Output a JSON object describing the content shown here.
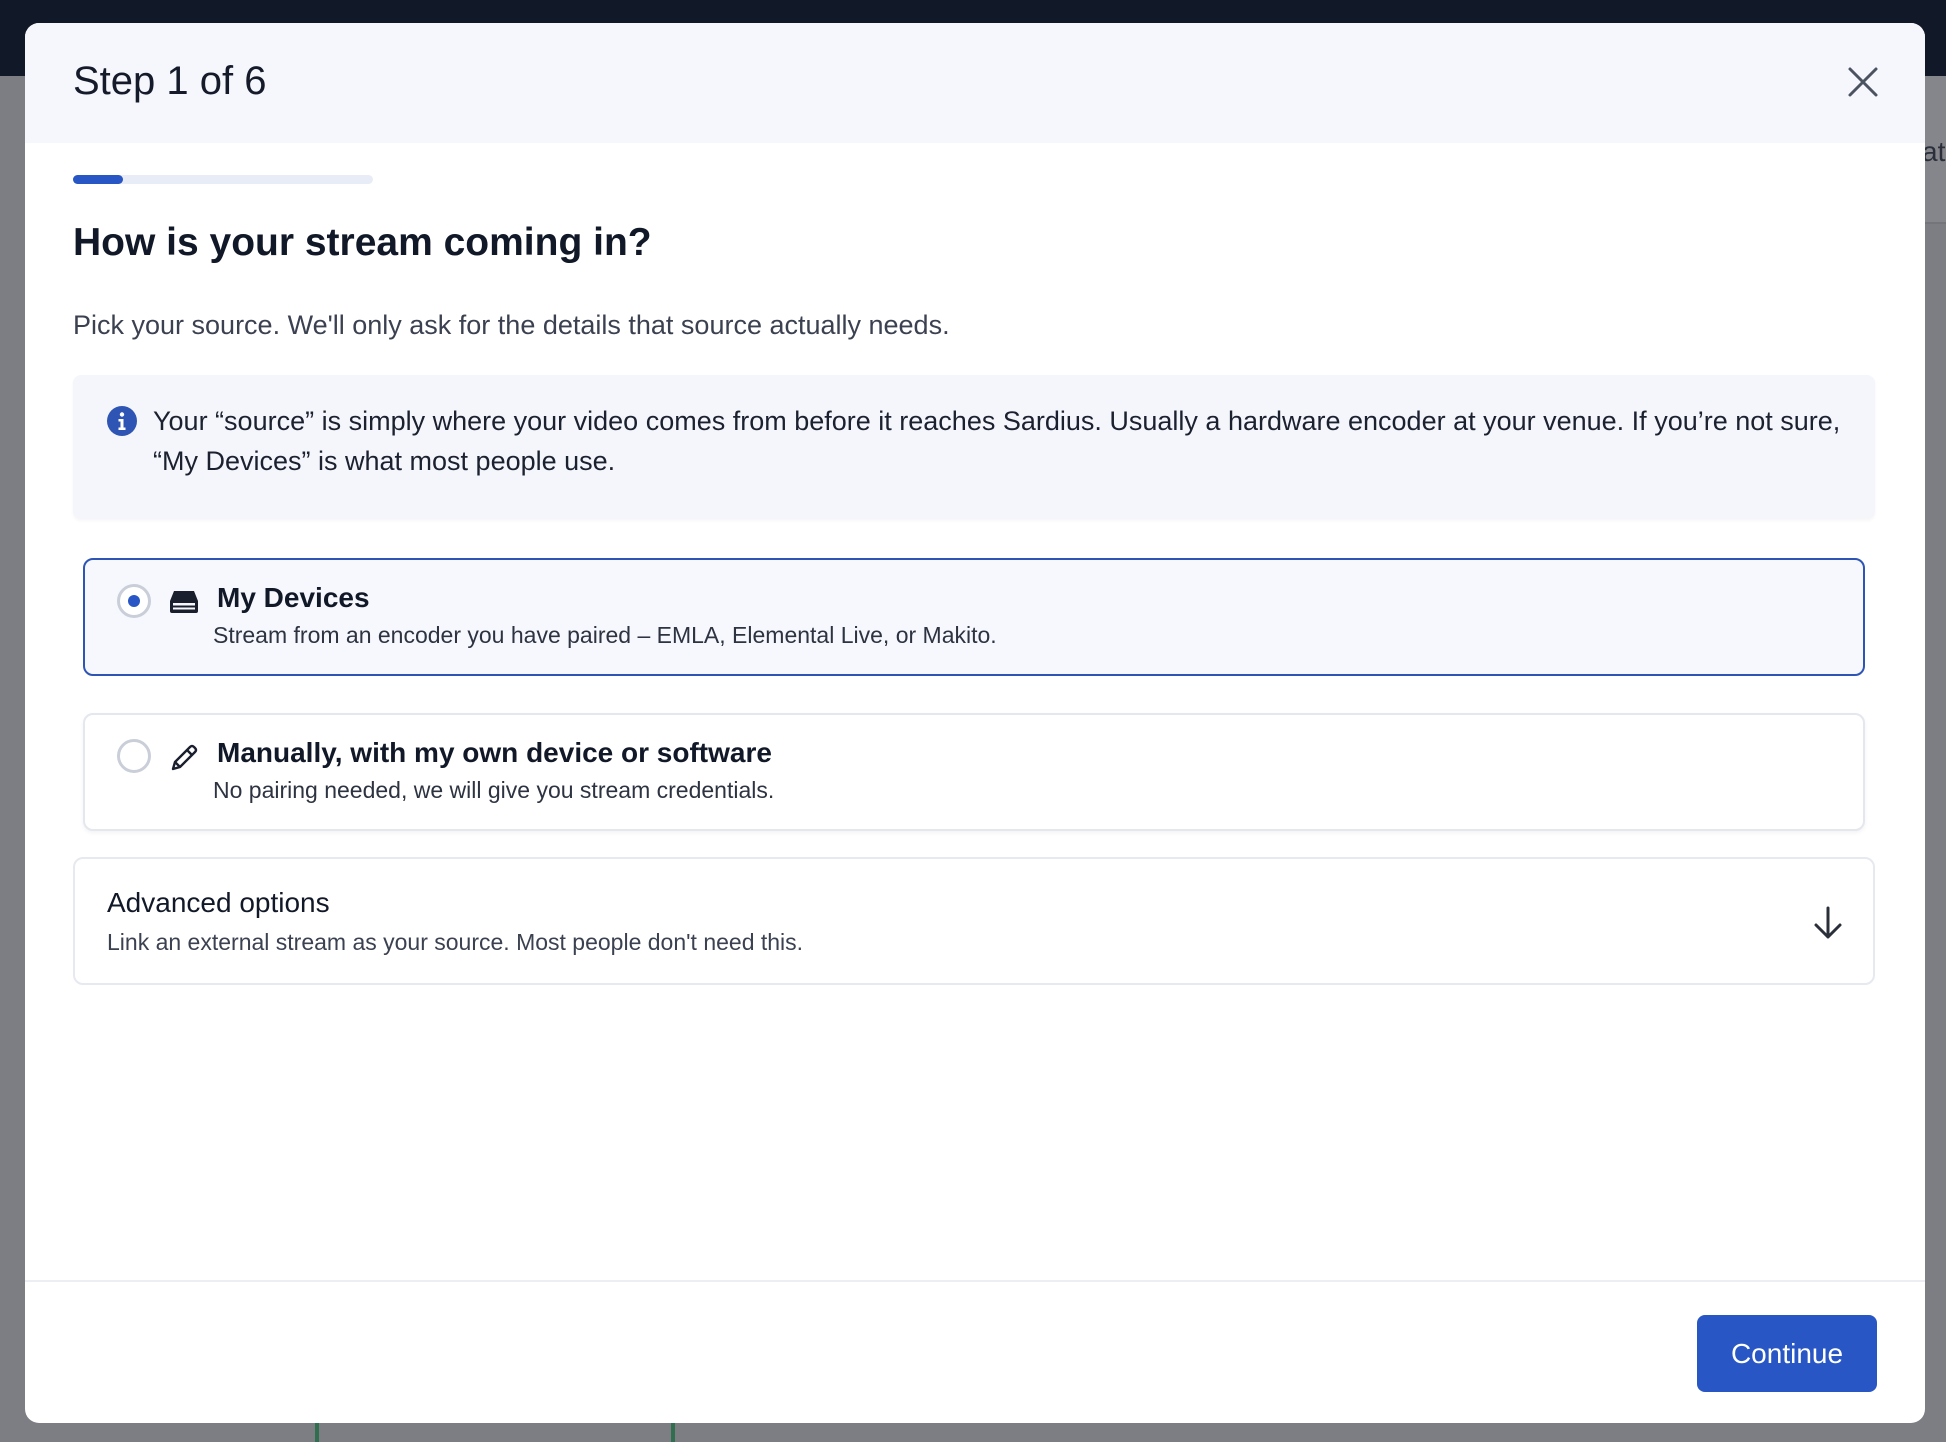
{
  "backdrop": {
    "partial_right_text": "at",
    "partial_bottom_text": "... ..."
  },
  "modal": {
    "step_title": "Step 1 of 6",
    "progress": {
      "current_step": 1,
      "total_steps": 6
    },
    "heading": "How is your stream coming in?",
    "subtitle": "Pick your source. We'll only ask for the details that source actually needs.",
    "info": {
      "icon": "info-icon",
      "text": "Your “source” is simply where your video comes from before it reaches Sardius. Usually a hardware encoder at your venue. If you’re not sure, “My Devices” is what most people use."
    },
    "options": [
      {
        "icon": "server-icon",
        "title": "My Devices",
        "description": "Stream from an encoder you have paired – EMLA, Elemental Live, or Makito.",
        "selected": true
      },
      {
        "icon": "pencil-icon",
        "title": "Manually, with my own device or software",
        "description": "No pairing needed, we will give you stream credentials.",
        "selected": false
      }
    ],
    "advanced": {
      "title": "Advanced options",
      "description": "Link an external stream as your source. Most people don't need this.",
      "icon": "arrow-down-icon"
    },
    "continue_label": "Continue"
  },
  "colors": {
    "accent": "#2857c5",
    "selected_border": "#2f55b4",
    "header_bg": "#f5f7fc",
    "info_bg": "#f4f6fb",
    "backdrop_topbar": "#111827"
  }
}
